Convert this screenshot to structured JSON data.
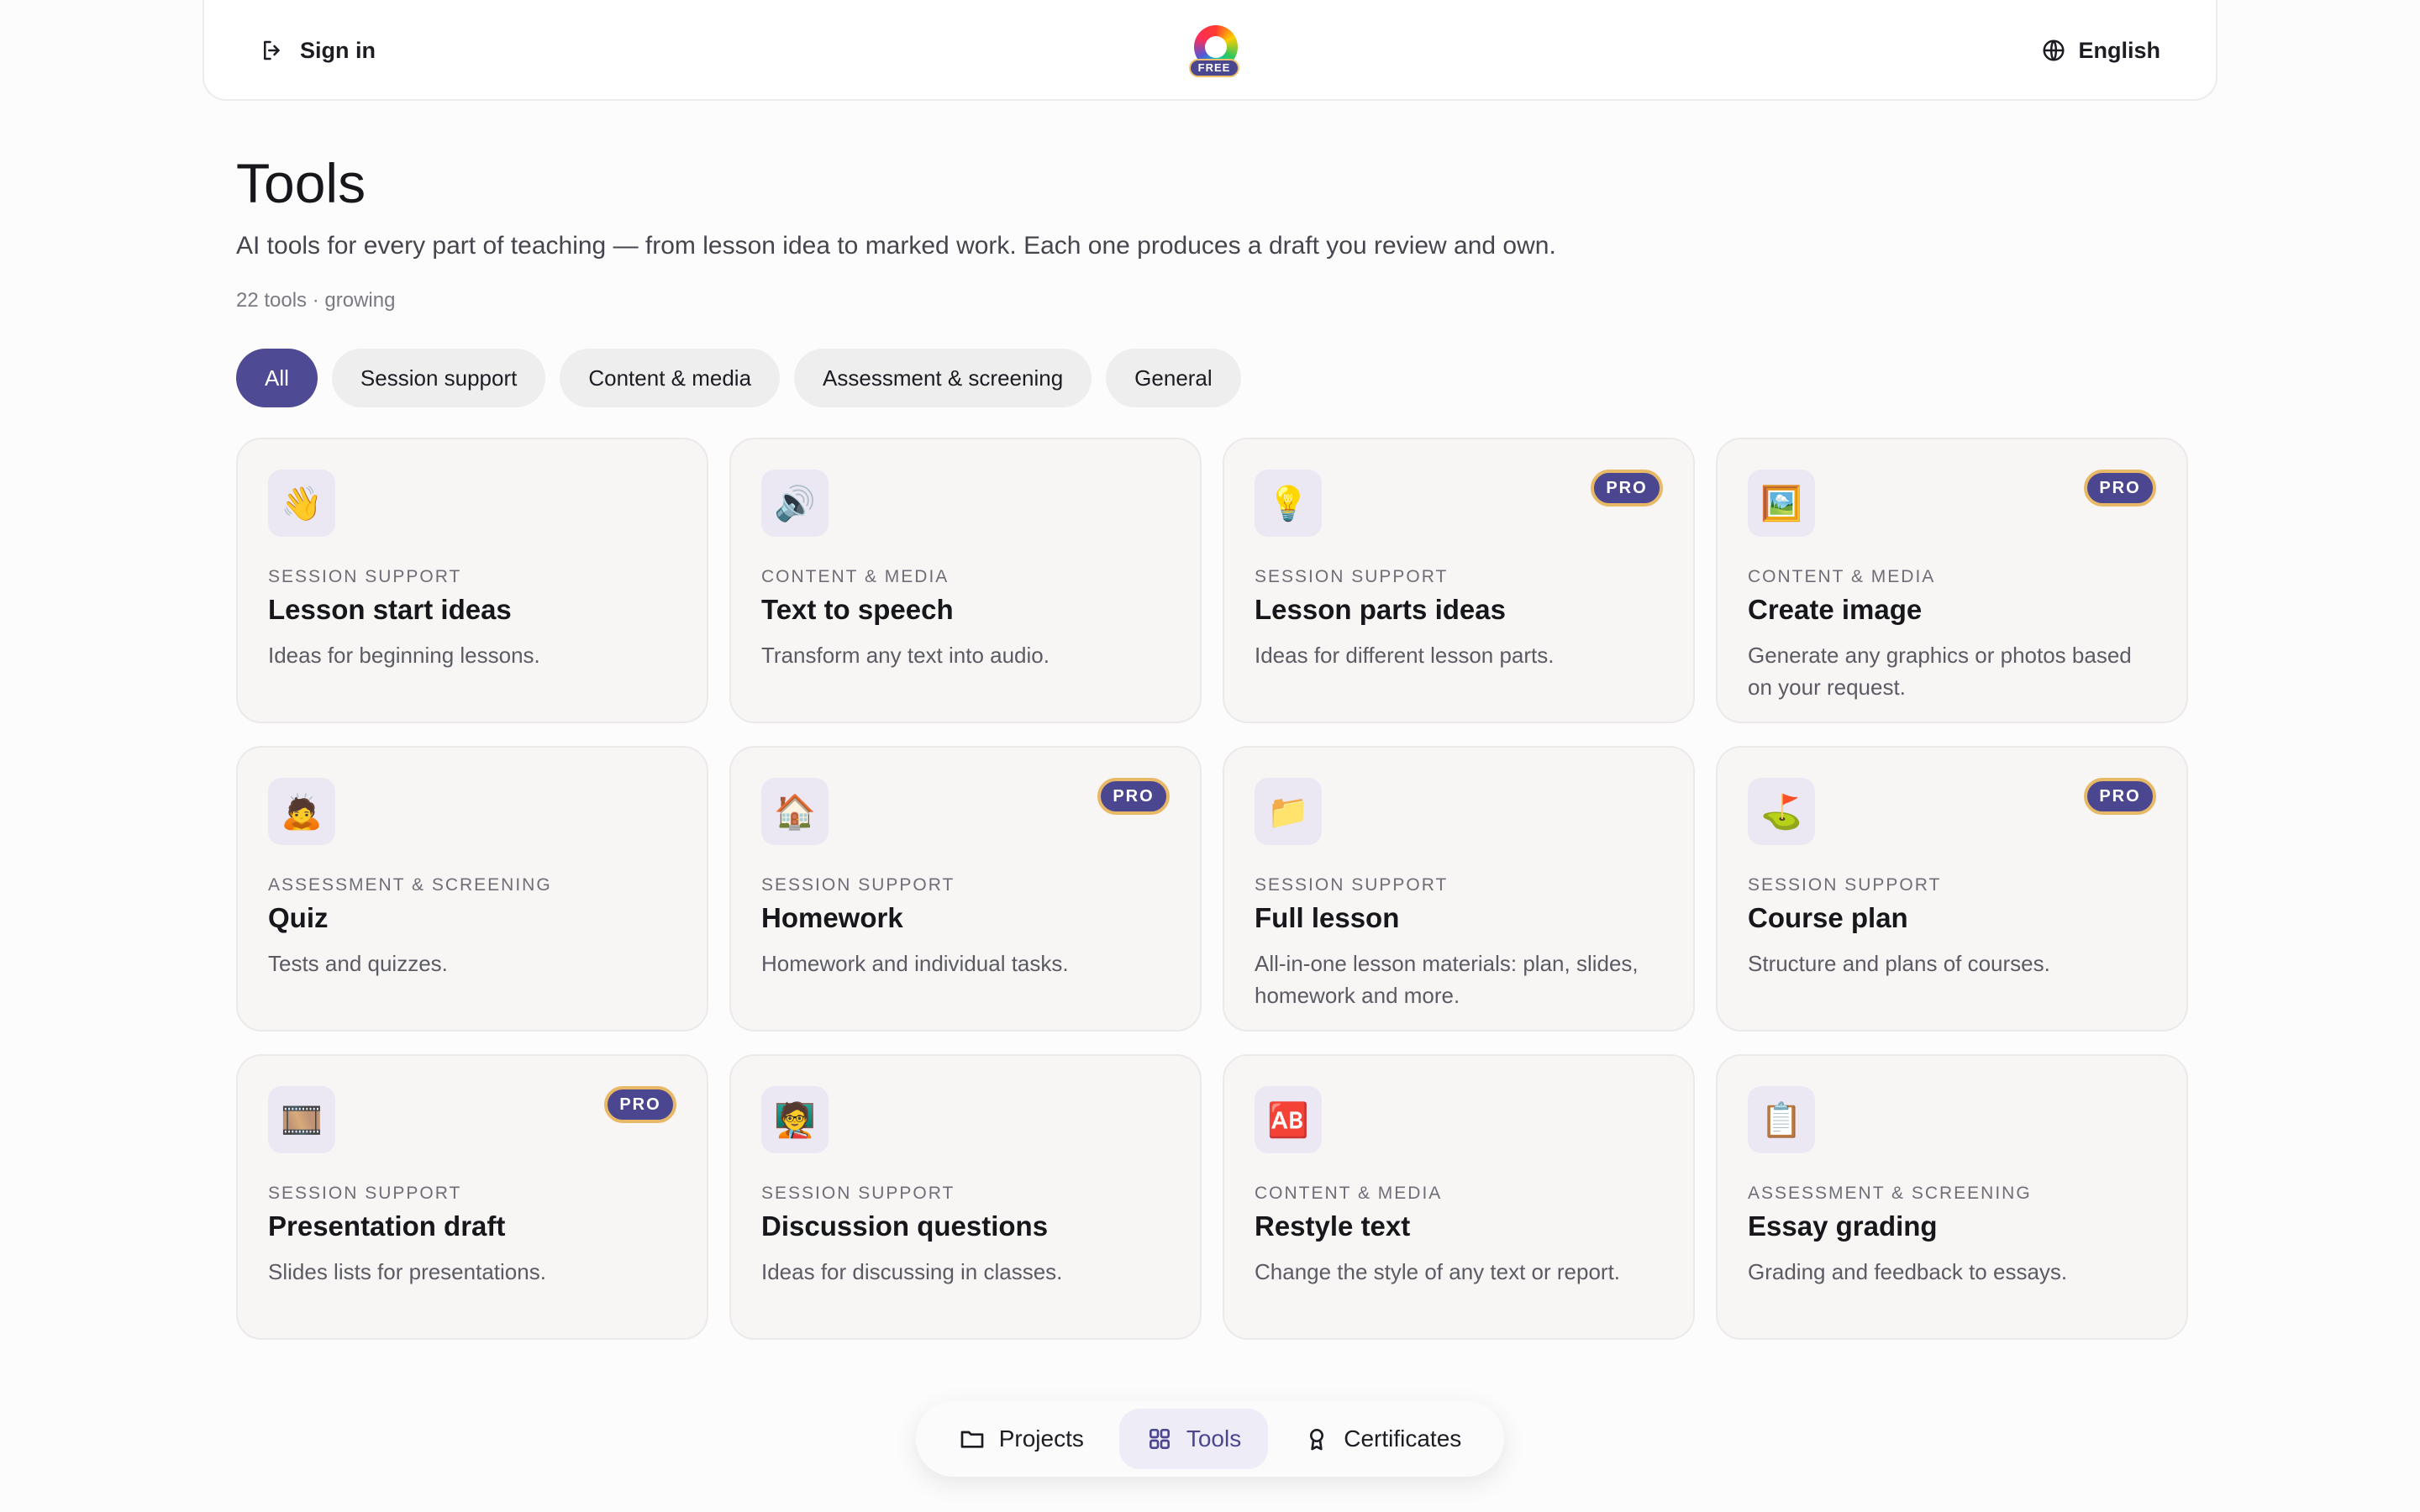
{
  "header": {
    "signin_label": "Sign in",
    "logo_badge": "FREE",
    "language_label": "English"
  },
  "main": {
    "title": "Tools",
    "subtitle": "AI tools for every part of teaching — from lesson idea to marked work. Each one produces a draft you review and own.",
    "count": "22 tools · growing"
  },
  "filters": [
    {
      "label": "All",
      "active": true
    },
    {
      "label": "Session support",
      "active": false
    },
    {
      "label": "Content & media",
      "active": false
    },
    {
      "label": "Assessment & screening",
      "active": false
    },
    {
      "label": "General",
      "active": false
    }
  ],
  "pro_label": "PRO",
  "tools": [
    {
      "icon": "👋",
      "icon_name": "waving-hand-icon",
      "category": "SESSION SUPPORT",
      "name": "Lesson start ideas",
      "desc": "Ideas for beginning lessons.",
      "pro": false
    },
    {
      "icon": "🔊",
      "icon_name": "speaker-icon",
      "category": "CONTENT & MEDIA",
      "name": "Text to speech",
      "desc": "Transform any text into audio.",
      "pro": false
    },
    {
      "icon": "💡",
      "icon_name": "light-bulb-icon",
      "category": "SESSION SUPPORT",
      "name": "Lesson parts ideas",
      "desc": "Ideas for different lesson parts.",
      "pro": true
    },
    {
      "icon": "🖼️",
      "icon_name": "framed-picture-icon",
      "category": "CONTENT & MEDIA",
      "name": "Create image",
      "desc": "Generate any graphics or photos based on your request.",
      "pro": true
    },
    {
      "icon": "🙇",
      "icon_name": "bowing-person-icon",
      "category": "ASSESSMENT & SCREENING",
      "name": "Quiz",
      "desc": "Tests and quizzes.",
      "pro": false
    },
    {
      "icon": "🏠",
      "icon_name": "house-icon",
      "category": "SESSION SUPPORT",
      "name": "Homework",
      "desc": "Homework and individual tasks.",
      "pro": true
    },
    {
      "icon": "📁",
      "icon_name": "folder-icon",
      "category": "SESSION SUPPORT",
      "name": "Full lesson",
      "desc": "All-in-one lesson materials: plan, slides, homework and more.",
      "pro": false
    },
    {
      "icon": "⛳",
      "icon_name": "golf-flag-icon",
      "category": "SESSION SUPPORT",
      "name": "Course plan",
      "desc": "Structure and plans of courses.",
      "pro": true
    },
    {
      "icon": "🎞️",
      "icon_name": "film-frames-icon",
      "category": "SESSION SUPPORT",
      "name": "Presentation draft",
      "desc": "Slides lists for presentations.",
      "pro": true
    },
    {
      "icon": "🧑‍🏫",
      "icon_name": "teacher-icon",
      "category": "SESSION SUPPORT",
      "name": "Discussion questions",
      "desc": "Ideas for discussing in classes.",
      "pro": false
    },
    {
      "icon": "🆎",
      "icon_name": "ab-button-icon",
      "category": "CONTENT & MEDIA",
      "name": "Restyle text",
      "desc": "Change the style of any text or report.",
      "pro": false
    },
    {
      "icon": "📋",
      "icon_name": "clipboard-icon",
      "category": "ASSESSMENT & SCREENING",
      "name": "Essay grading",
      "desc": "Grading and feedback to essays.",
      "pro": false
    }
  ],
  "bottom_nav": [
    {
      "label": "Projects",
      "icon_name": "folder-icon",
      "active": false
    },
    {
      "label": "Tools",
      "icon_name": "grid-icon",
      "active": true
    },
    {
      "label": "Certificates",
      "icon_name": "award-icon",
      "active": false
    }
  ],
  "colors": {
    "accent": "#4e4a93",
    "pro_border": "#e7b866"
  }
}
